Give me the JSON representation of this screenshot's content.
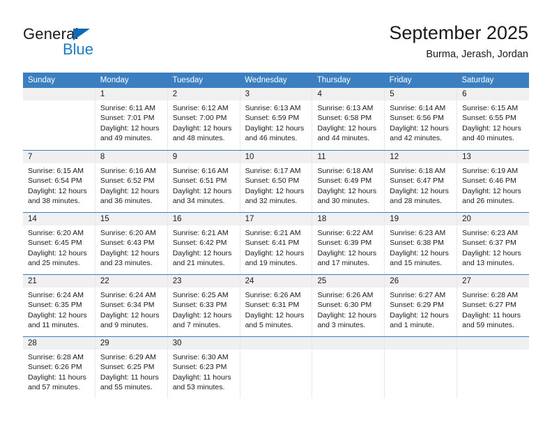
{
  "brand": {
    "name_part1": "General",
    "name_part2": "Blue",
    "triangle_icon": "triangle-icon",
    "accent_color": "#1e7bc4"
  },
  "header": {
    "title": "September 2025",
    "subtitle": "Burma, Jerash, Jordan"
  },
  "theme": {
    "header_blue": "#3b7fc0",
    "daynum_band": "#f0f0f0",
    "cell_border": "#e8e8e8",
    "text": "#1a1a1a"
  },
  "weekdays": [
    "Sunday",
    "Monday",
    "Tuesday",
    "Wednesday",
    "Thursday",
    "Friday",
    "Saturday"
  ],
  "labels": {
    "sunrise_prefix": "Sunrise:",
    "sunset_prefix": "Sunset:",
    "daylight_prefix": "Daylight:"
  },
  "weeks": [
    [
      {
        "day": "",
        "sunrise": "",
        "sunset": "",
        "daylight": "",
        "empty": true
      },
      {
        "day": "1",
        "sunrise": "Sunrise: 6:11 AM",
        "sunset": "Sunset: 7:01 PM",
        "daylight": "Daylight: 12 hours and 49 minutes."
      },
      {
        "day": "2",
        "sunrise": "Sunrise: 6:12 AM",
        "sunset": "Sunset: 7:00 PM",
        "daylight": "Daylight: 12 hours and 48 minutes."
      },
      {
        "day": "3",
        "sunrise": "Sunrise: 6:13 AM",
        "sunset": "Sunset: 6:59 PM",
        "daylight": "Daylight: 12 hours and 46 minutes."
      },
      {
        "day": "4",
        "sunrise": "Sunrise: 6:13 AM",
        "sunset": "Sunset: 6:58 PM",
        "daylight": "Daylight: 12 hours and 44 minutes."
      },
      {
        "day": "5",
        "sunrise": "Sunrise: 6:14 AM",
        "sunset": "Sunset: 6:56 PM",
        "daylight": "Daylight: 12 hours and 42 minutes."
      },
      {
        "day": "6",
        "sunrise": "Sunrise: 6:15 AM",
        "sunset": "Sunset: 6:55 PM",
        "daylight": "Daylight: 12 hours and 40 minutes."
      }
    ],
    [
      {
        "day": "7",
        "sunrise": "Sunrise: 6:15 AM",
        "sunset": "Sunset: 6:54 PM",
        "daylight": "Daylight: 12 hours and 38 minutes."
      },
      {
        "day": "8",
        "sunrise": "Sunrise: 6:16 AM",
        "sunset": "Sunset: 6:52 PM",
        "daylight": "Daylight: 12 hours and 36 minutes."
      },
      {
        "day": "9",
        "sunrise": "Sunrise: 6:16 AM",
        "sunset": "Sunset: 6:51 PM",
        "daylight": "Daylight: 12 hours and 34 minutes."
      },
      {
        "day": "10",
        "sunrise": "Sunrise: 6:17 AM",
        "sunset": "Sunset: 6:50 PM",
        "daylight": "Daylight: 12 hours and 32 minutes."
      },
      {
        "day": "11",
        "sunrise": "Sunrise: 6:18 AM",
        "sunset": "Sunset: 6:49 PM",
        "daylight": "Daylight: 12 hours and 30 minutes."
      },
      {
        "day": "12",
        "sunrise": "Sunrise: 6:18 AM",
        "sunset": "Sunset: 6:47 PM",
        "daylight": "Daylight: 12 hours and 28 minutes."
      },
      {
        "day": "13",
        "sunrise": "Sunrise: 6:19 AM",
        "sunset": "Sunset: 6:46 PM",
        "daylight": "Daylight: 12 hours and 26 minutes."
      }
    ],
    [
      {
        "day": "14",
        "sunrise": "Sunrise: 6:20 AM",
        "sunset": "Sunset: 6:45 PM",
        "daylight": "Daylight: 12 hours and 25 minutes."
      },
      {
        "day": "15",
        "sunrise": "Sunrise: 6:20 AM",
        "sunset": "Sunset: 6:43 PM",
        "daylight": "Daylight: 12 hours and 23 minutes."
      },
      {
        "day": "16",
        "sunrise": "Sunrise: 6:21 AM",
        "sunset": "Sunset: 6:42 PM",
        "daylight": "Daylight: 12 hours and 21 minutes."
      },
      {
        "day": "17",
        "sunrise": "Sunrise: 6:21 AM",
        "sunset": "Sunset: 6:41 PM",
        "daylight": "Daylight: 12 hours and 19 minutes."
      },
      {
        "day": "18",
        "sunrise": "Sunrise: 6:22 AM",
        "sunset": "Sunset: 6:39 PM",
        "daylight": "Daylight: 12 hours and 17 minutes."
      },
      {
        "day": "19",
        "sunrise": "Sunrise: 6:23 AM",
        "sunset": "Sunset: 6:38 PM",
        "daylight": "Daylight: 12 hours and 15 minutes."
      },
      {
        "day": "20",
        "sunrise": "Sunrise: 6:23 AM",
        "sunset": "Sunset: 6:37 PM",
        "daylight": "Daylight: 12 hours and 13 minutes."
      }
    ],
    [
      {
        "day": "21",
        "sunrise": "Sunrise: 6:24 AM",
        "sunset": "Sunset: 6:35 PM",
        "daylight": "Daylight: 12 hours and 11 minutes."
      },
      {
        "day": "22",
        "sunrise": "Sunrise: 6:24 AM",
        "sunset": "Sunset: 6:34 PM",
        "daylight": "Daylight: 12 hours and 9 minutes."
      },
      {
        "day": "23",
        "sunrise": "Sunrise: 6:25 AM",
        "sunset": "Sunset: 6:33 PM",
        "daylight": "Daylight: 12 hours and 7 minutes."
      },
      {
        "day": "24",
        "sunrise": "Sunrise: 6:26 AM",
        "sunset": "Sunset: 6:31 PM",
        "daylight": "Daylight: 12 hours and 5 minutes."
      },
      {
        "day": "25",
        "sunrise": "Sunrise: 6:26 AM",
        "sunset": "Sunset: 6:30 PM",
        "daylight": "Daylight: 12 hours and 3 minutes."
      },
      {
        "day": "26",
        "sunrise": "Sunrise: 6:27 AM",
        "sunset": "Sunset: 6:29 PM",
        "daylight": "Daylight: 12 hours and 1 minute."
      },
      {
        "day": "27",
        "sunrise": "Sunrise: 6:28 AM",
        "sunset": "Sunset: 6:27 PM",
        "daylight": "Daylight: 11 hours and 59 minutes."
      }
    ],
    [
      {
        "day": "28",
        "sunrise": "Sunrise: 6:28 AM",
        "sunset": "Sunset: 6:26 PM",
        "daylight": "Daylight: 11 hours and 57 minutes."
      },
      {
        "day": "29",
        "sunrise": "Sunrise: 6:29 AM",
        "sunset": "Sunset: 6:25 PM",
        "daylight": "Daylight: 11 hours and 55 minutes."
      },
      {
        "day": "30",
        "sunrise": "Sunrise: 6:30 AM",
        "sunset": "Sunset: 6:23 PM",
        "daylight": "Daylight: 11 hours and 53 minutes."
      },
      {
        "day": "",
        "sunrise": "",
        "sunset": "",
        "daylight": "",
        "empty": true
      },
      {
        "day": "",
        "sunrise": "",
        "sunset": "",
        "daylight": "",
        "empty": true
      },
      {
        "day": "",
        "sunrise": "",
        "sunset": "",
        "daylight": "",
        "empty": true
      },
      {
        "day": "",
        "sunrise": "",
        "sunset": "",
        "daylight": "",
        "empty": true
      }
    ]
  ]
}
